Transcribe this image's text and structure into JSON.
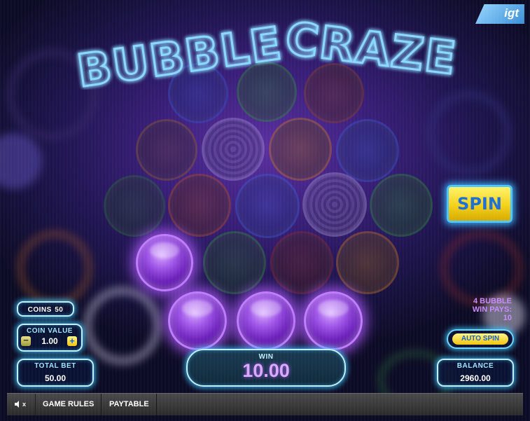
{
  "game": {
    "title_part1": "BUBBLE",
    "title_part2": "CRAZE",
    "provider_logo": "igt"
  },
  "controls": {
    "spin_label": "SPIN",
    "auto_spin_label": "AUTO SPIN"
  },
  "bet": {
    "coins_label": "COINS",
    "coins_value": "50",
    "coin_value_label": "COIN VALUE",
    "coin_value": "1.00",
    "minus_icon": "minus-icon",
    "plus_icon": "plus-icon",
    "total_bet_label": "TOTAL BET",
    "total_bet_value": "50.00"
  },
  "win": {
    "label": "WIN",
    "value": "10.00",
    "info_line1": "4 BUBBLE",
    "info_line2": "WIN PAYS:",
    "info_line3": "10"
  },
  "balance": {
    "label": "BALANCE",
    "value": "2960.00"
  },
  "bottom_bar": {
    "mute_icon": "speaker-mute-icon",
    "mute_suffix": "x",
    "game_rules_label": "GAME RULES",
    "paytable_label": "PAYTABLE"
  },
  "colors": {
    "accent_cyan": "#4fc6ff",
    "spin_yellow": "#f4d11a",
    "lit_bubble_purple": "#a056e8",
    "win_info_text": "#c88cff"
  }
}
